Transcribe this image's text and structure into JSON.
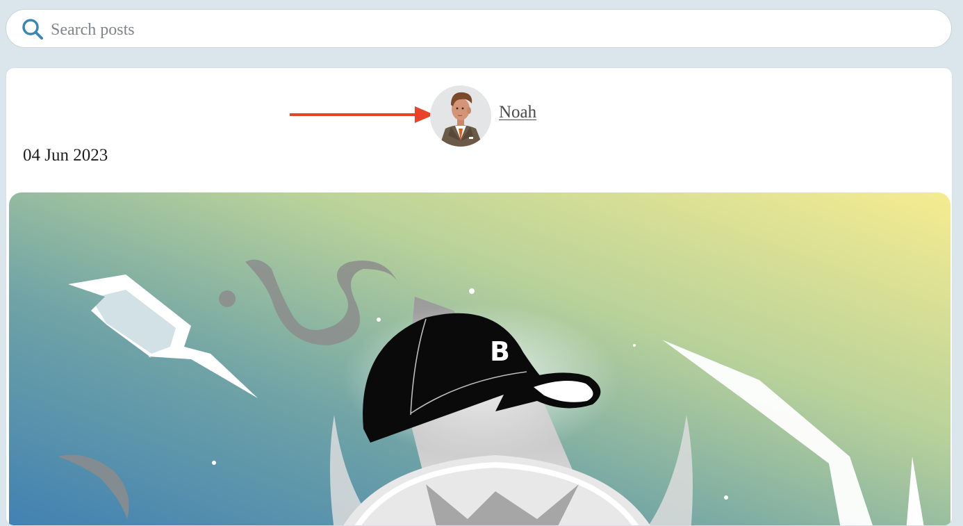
{
  "search": {
    "placeholder": "Search posts",
    "icon": "search-icon",
    "icon_color": "#3a87b5"
  },
  "post": {
    "author": "Noah",
    "date": "04 Jun 2023",
    "annotation_arrow_color": "#e8432a",
    "image_alt": "Illustration of a black baseball cap with a letter B on a gradient background"
  },
  "image_text": {
    "cap_letter": "B"
  }
}
